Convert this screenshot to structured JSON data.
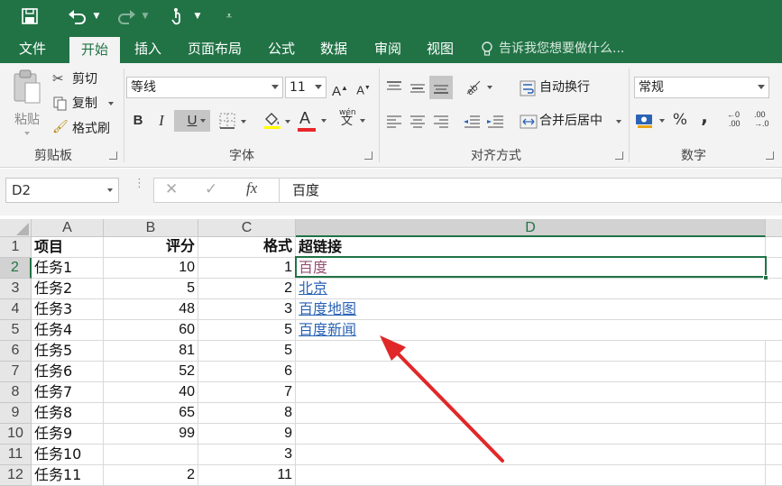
{
  "menu": {
    "file": "文件",
    "home": "开始",
    "insert": "插入",
    "layout": "页面布局",
    "formulas": "公式",
    "data": "数据",
    "review": "审阅",
    "view": "视图",
    "tell_me": "告诉我您想要做什么..."
  },
  "ribbon": {
    "clipboard": {
      "paste": "粘贴",
      "cut": "剪切",
      "copy": "复制",
      "format_painter": "格式刷",
      "label": "剪贴板"
    },
    "font": {
      "name": "等线",
      "size": "11",
      "label": "字体",
      "bold": "B",
      "italic": "I",
      "underline": "U",
      "grow": "A",
      "shrink": "A",
      "color_a": "A",
      "phonetic_top": "wén",
      "phonetic_bottom": "文"
    },
    "alignment": {
      "wrap": "自动换行",
      "merge": "合并后居中",
      "label": "对齐方式"
    },
    "number": {
      "format": "常规",
      "label": "数字",
      "percent": "%",
      "comma": ",",
      "inc_top": "←0",
      "inc_bottom": ".00",
      "dec_top": ".00",
      "dec_bottom": "→.0"
    },
    "colors": {
      "accent": "#217346",
      "font_color": "#e8262a"
    }
  },
  "formula_bar": {
    "name_box": "D2",
    "cancel": "✕",
    "enter": "✓",
    "fx": "fx",
    "value": "百度"
  },
  "sheet": {
    "columns": [
      "A",
      "B",
      "C",
      "D"
    ],
    "rows": [
      "1",
      "2",
      "3",
      "4",
      "5",
      "6",
      "7",
      "8",
      "9",
      "10",
      "11",
      "12"
    ],
    "headers": {
      "a": "项目",
      "b": "评分",
      "c": "格式",
      "d": "超链接"
    },
    "data": [
      {
        "a": "任务1",
        "b": "10",
        "c": "1",
        "d": "百度"
      },
      {
        "a": "任务2",
        "b": "5",
        "c": "2",
        "d": "北京"
      },
      {
        "a": "任务3",
        "b": "48",
        "c": "3",
        "d": "百度地图"
      },
      {
        "a": "任务4",
        "b": "60",
        "c": "5",
        "d": "百度新闻"
      },
      {
        "a": "任务5",
        "b": "81",
        "c": "5",
        "d": ""
      },
      {
        "a": "任务6",
        "b": "52",
        "c": "6",
        "d": ""
      },
      {
        "a": "任务7",
        "b": "40",
        "c": "7",
        "d": ""
      },
      {
        "a": "任务8",
        "b": "65",
        "c": "8",
        "d": ""
      },
      {
        "a": "任务9",
        "b": "99",
        "c": "9",
        "d": ""
      },
      {
        "a": "任务10",
        "b": "",
        "c": "3",
        "d": ""
      },
      {
        "a": "任务11",
        "b": "2",
        "c": "11",
        "d": ""
      }
    ],
    "link_color": "#2b63b5",
    "visited_color": "#954f72",
    "arrow_color": "#e02828"
  }
}
